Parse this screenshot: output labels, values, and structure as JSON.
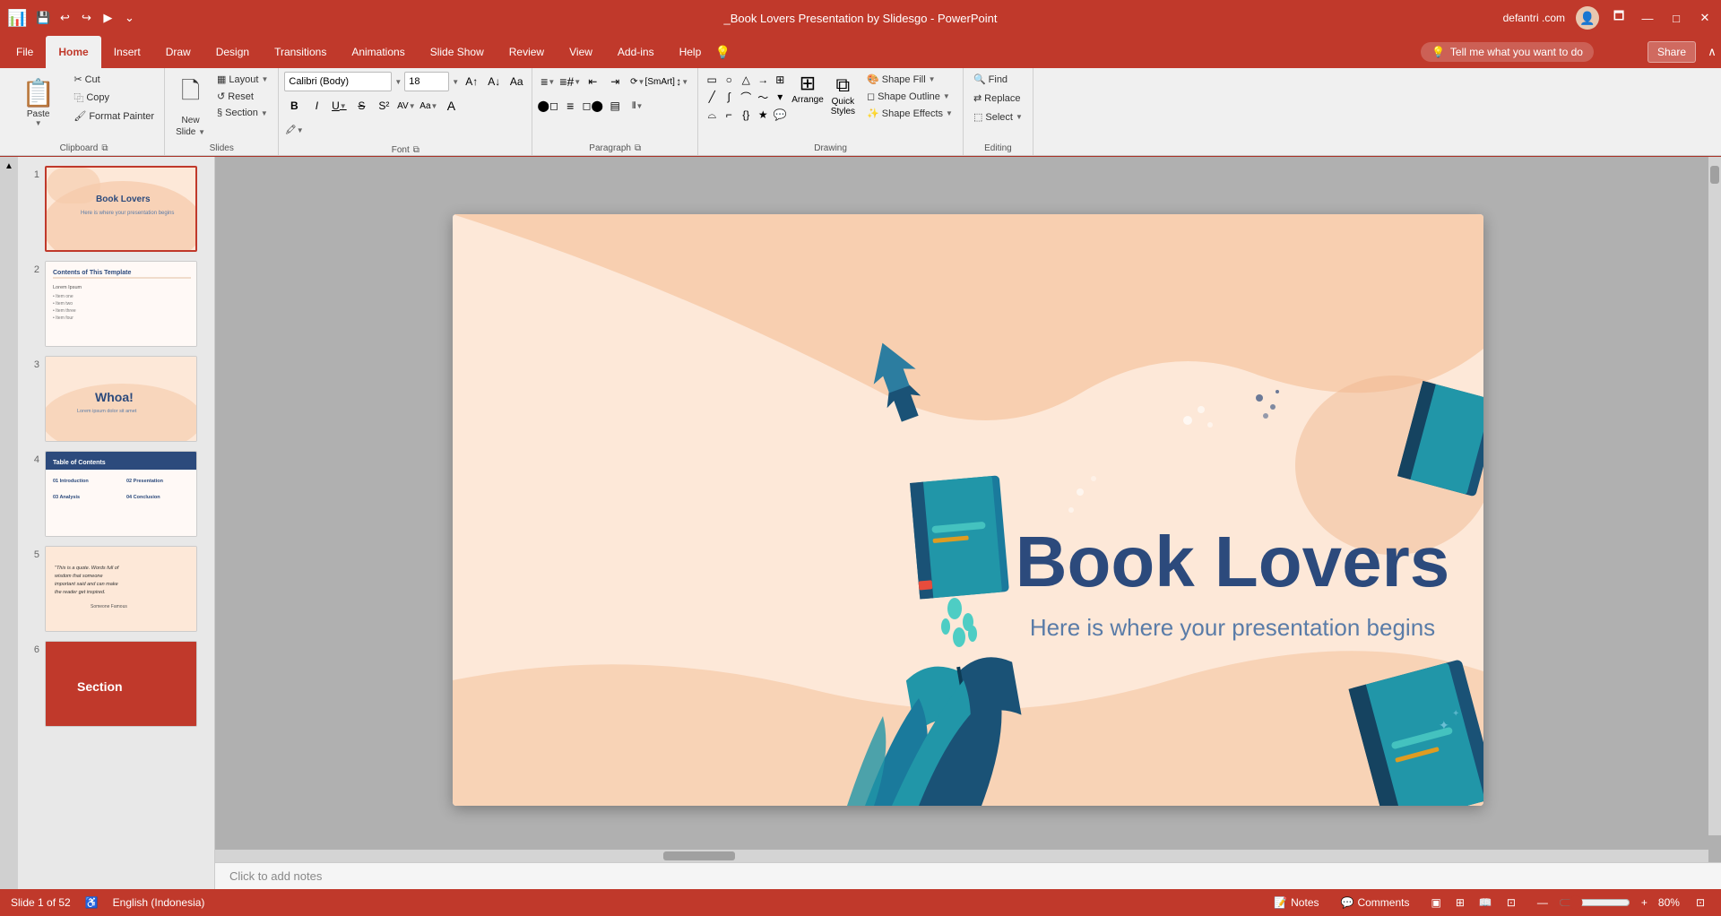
{
  "titlebar": {
    "title": "_Book Lovers Presentation by Slidesgo - PowerPoint",
    "user": "defantri .com",
    "quickaccess": [
      "save",
      "undo",
      "redo",
      "customize"
    ]
  },
  "tabs": [
    {
      "label": "File",
      "active": false
    },
    {
      "label": "Home",
      "active": true
    },
    {
      "label": "Insert",
      "active": false
    },
    {
      "label": "Draw",
      "active": false
    },
    {
      "label": "Design",
      "active": false
    },
    {
      "label": "Transitions",
      "active": false
    },
    {
      "label": "Animations",
      "active": false
    },
    {
      "label": "Slide Show",
      "active": false
    },
    {
      "label": "Review",
      "active": false
    },
    {
      "label": "View",
      "active": false
    },
    {
      "label": "Add-ins",
      "active": false
    },
    {
      "label": "Help",
      "active": false
    }
  ],
  "tell_me": "Tell me what you want to do",
  "share": "Share",
  "ribbon": {
    "groups": [
      {
        "name": "Clipboard",
        "buttons": [
          "Paste",
          "Cut",
          "Copy",
          "Format Painter"
        ]
      },
      {
        "name": "Slides",
        "buttons": [
          "New Slide",
          "Layout",
          "Reset",
          "Section"
        ]
      },
      {
        "name": "Font",
        "font_family": "Calibri (Body)",
        "font_size": "18",
        "bold": "B",
        "italic": "I",
        "underline": "U",
        "strikethrough": "S"
      },
      {
        "name": "Paragraph",
        "buttons": [
          "Bullets",
          "Numbered",
          "Decrease Indent",
          "Increase Indent"
        ]
      },
      {
        "name": "Drawing",
        "buttons": [
          "Arrange",
          "Quick Styles",
          "Shape Fill",
          "Shape Outline",
          "Shape Effects"
        ]
      },
      {
        "name": "Editing",
        "buttons": [
          "Find",
          "Replace",
          "Select"
        ]
      }
    ]
  },
  "slide": {
    "title": "Book Lovers",
    "subtitle": "Here is where your presentation begins",
    "bg_color": "#fde8d8"
  },
  "thumbnails": [
    {
      "num": 1,
      "label": "Book Lovers title slide",
      "active": true
    },
    {
      "num": 2,
      "label": "Contents slide",
      "active": false
    },
    {
      "num": 3,
      "label": "Whoa! section slide",
      "active": false
    },
    {
      "num": 4,
      "label": "Table of Contents slide",
      "active": false
    },
    {
      "num": 5,
      "label": "Quote slide",
      "active": false
    },
    {
      "num": 6,
      "label": "Orange section slide",
      "active": false
    }
  ],
  "status": {
    "slide_info": "Slide 1 of 52",
    "language": "English (Indonesia)",
    "notes": "Notes",
    "comments": "Comments",
    "zoom": "80%"
  },
  "notes_placeholder": "Click to add notes"
}
